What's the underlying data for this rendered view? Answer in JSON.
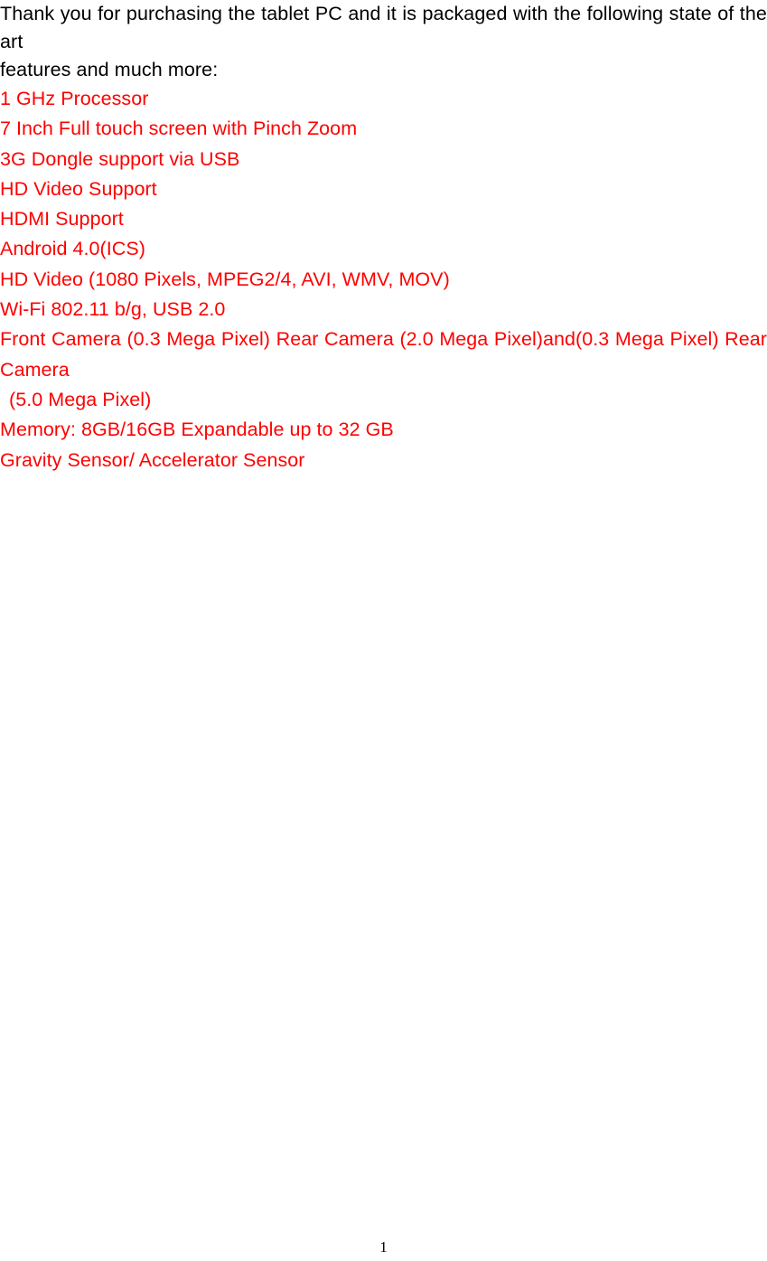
{
  "document": {
    "colors": {
      "body_text": "#000000",
      "feature_text": "#FF0000",
      "background": "#FFFFFF"
    },
    "intro": {
      "line_1": "Thank you for purchasing the tablet PC and it is packaged with the following state of the art",
      "line_2": "features and much more:"
    },
    "features": [
      {
        "text": "1 GHz Processor"
      },
      {
        "text": "7 Inch Full touch screen with Pinch Zoom"
      },
      {
        "text": "3G Dongle support via USB"
      },
      {
        "text": "HD Video Support"
      },
      {
        "text": "HDMI Support"
      },
      {
        "text": "Android 4.0(ICS)"
      },
      {
        "text": "HD Video (1080 Pixels, MPEG2/4, AVI, WMV, MOV)"
      },
      {
        "text": "Wi-Fi 802.11 b/g, USB 2.0"
      }
    ],
    "camera_feature": {
      "line_1": "Front Camera (0.3 Mega Pixel) Rear Camera (2.0 Mega Pixel)and(0.3 Mega Pixel) Rear Camera",
      "line_2": "(5.0 Mega Pixel)"
    },
    "features_tail": [
      {
        "text": "Memory: 8GB/16GB Expandable up to 32 GB"
      },
      {
        "text": "Gravity Sensor/ Accelerator Sensor"
      }
    ],
    "footer": {
      "page_number": "1"
    }
  }
}
